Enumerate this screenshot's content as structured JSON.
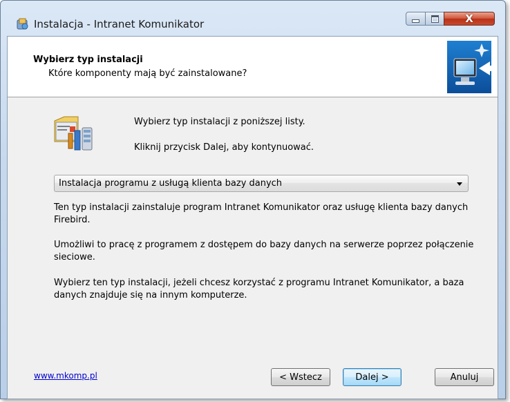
{
  "window": {
    "title": "Instalacja - Intranet Komunikator",
    "controls": {
      "minimize_icon": "minimize-icon",
      "maximize_icon": "maximize-icon",
      "close_icon": "close-icon",
      "close_glyph": "X"
    }
  },
  "header": {
    "title": "Wybierz typ instalacji",
    "subtitle": "Które komponenty mają być zainstalowane?"
  },
  "body": {
    "intro_line1": "Wybierz typ instalacji z poniższej listy.",
    "intro_line2": "Kliknij przycisk Dalej, aby kontynuować.",
    "install_type": {
      "selected": "Instalacja programu z usługą klienta bazy danych"
    },
    "description": [
      "Ten typ instalacji zainstaluje program Intranet Komunikator oraz usługę klienta bazy danych Firebird.",
      "Umożliwi to pracę z programem z dostępem do bazy danych na serwerze poprzez połączenie sieciowe.",
      "Wybierz ten typ instalacji, jeżeli chcesz korzystać z programu Intranet Komunikator, a baza danych znajduje się na innym komputerze."
    ]
  },
  "footer": {
    "link": "www.mkomp.pl",
    "back_label": "< Wstecz",
    "next_label": "Dalej >",
    "cancel_label": "Anuluj"
  },
  "colors": {
    "link": "#0000cc",
    "default_button_border": "#3c7fb1",
    "close_button": "#c94a2c"
  }
}
